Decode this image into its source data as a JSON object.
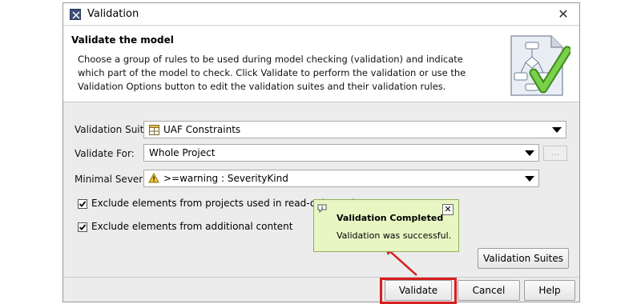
{
  "window": {
    "title": "Validation",
    "close_glyph": "✕"
  },
  "banner": {
    "heading": "Validate the model",
    "description": "Choose a group of rules to be used during model checking (validation) and indicate which part of the model to check. Click Validate to perform the validation or use the Validation Options button to edit the validation suites and their validation rules."
  },
  "form": {
    "suite_label": "Validation Suite:",
    "suite_value": "UAF Constraints",
    "validate_for_label": "Validate For:",
    "validate_for_value": "Whole Project",
    "dots_label": "...",
    "severity_label": "Minimal Severity:",
    "severity_value": ">=warning : SeverityKind",
    "exclude_readonly_label": "Exclude elements from projects used in read-only mode",
    "exclude_readonly_checked": true,
    "exclude_additional_label": "Exclude elements from additional content",
    "exclude_additional_checked": true
  },
  "popup": {
    "title": "Validation Completed",
    "message": "Validation was successful.",
    "close_glyph": "✕"
  },
  "buttons": {
    "validation_suites": "Validation Suites",
    "validate": "Validate",
    "cancel": "Cancel",
    "help": "Help"
  },
  "colors": {
    "popup_bg": "#e8f6c3",
    "highlight": "#d81e1e",
    "checkmark": "#5cb82e"
  }
}
